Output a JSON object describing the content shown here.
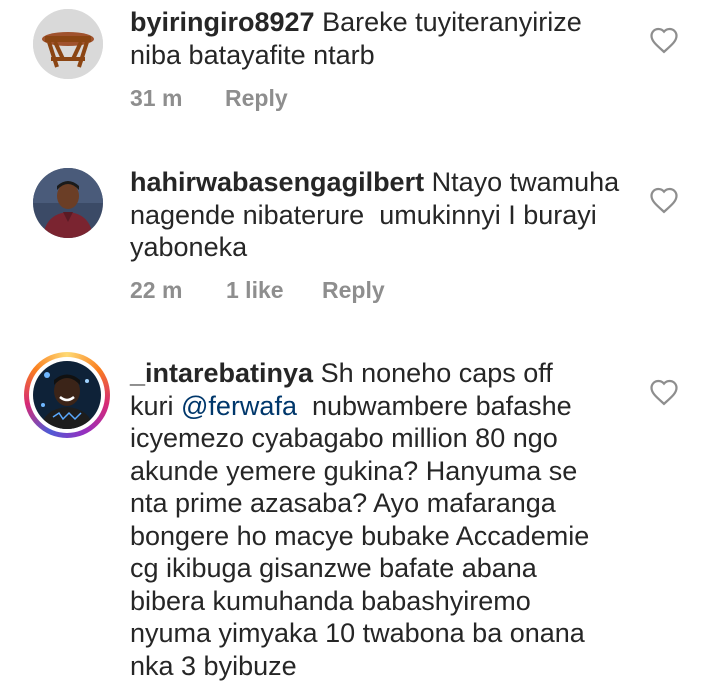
{
  "comments": [
    {
      "username": "byiringiro8927",
      "text_lines": [
        "Bareke tuyiteranyirize",
        "niba batayafite ntarb"
      ],
      "time": "31 m",
      "likes": "",
      "reply": "Reply",
      "avatar_icon": "wooden-stool-avatar",
      "story_ring": false
    },
    {
      "username": "hahirwabasengagilbert",
      "text_lines": [
        "Ntayo twamuha",
        "nagende nibaterure  umukinnyi I burayi",
        "yaboneka"
      ],
      "time": "22 m",
      "likes": "1 like",
      "reply": "Reply",
      "avatar_icon": "man-portrait-avatar",
      "story_ring": false
    },
    {
      "username": "_intarebatinya",
      "text_before_mention": "Sh noneho caps off",
      "text_kuri": "kuri ",
      "mention": "@ferwafa",
      "text_lines": [
        "icyemezo cyabagabo million 80 ngo",
        "akunde yemere gukina? Hanyuma se",
        "nta prime azasaba? Ayo mafaranga",
        "bongere ho macye bubake Accademie",
        "cg ikibuga gisanzwe bafate abana",
        "bibera kumuhanda babashyiremo",
        "nyuma yimyaka 10 twabona ba onana",
        "nka 3 byibuze"
      ],
      "after_mention": "  nubwambere bafashe",
      "avatar_icon": "smiling-man-avatar",
      "story_ring": true
    }
  ],
  "colors": {
    "text": "#262626",
    "meta": "#8e8e8e",
    "mention": "#00376b",
    "heart_stroke": "#8e8e8e"
  },
  "icons": {
    "like": "heart-outline-icon"
  }
}
